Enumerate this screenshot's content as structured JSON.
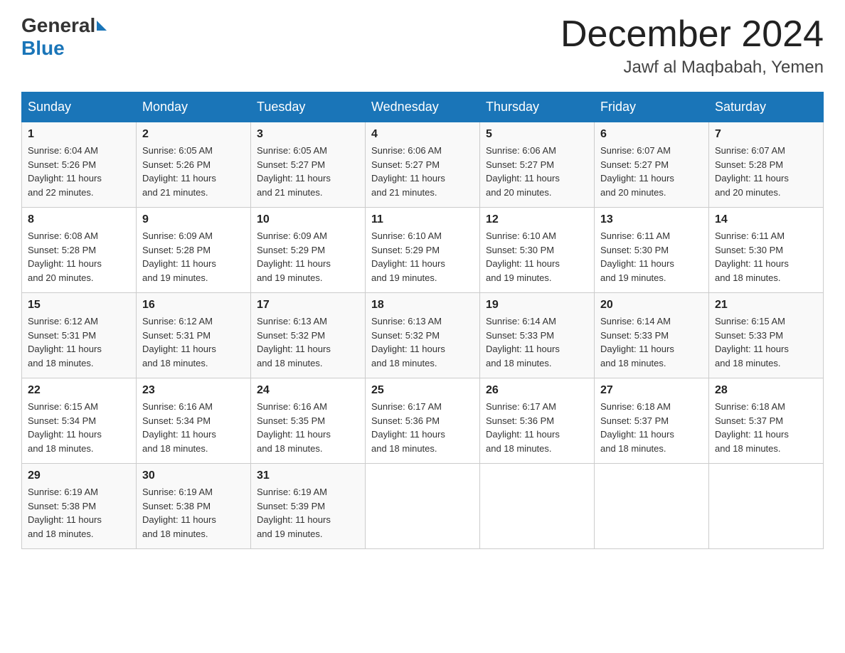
{
  "logo": {
    "general": "General",
    "blue": "Blue"
  },
  "header": {
    "month": "December 2024",
    "location": "Jawf al Maqbabah, Yemen"
  },
  "weekdays": [
    "Sunday",
    "Monday",
    "Tuesday",
    "Wednesday",
    "Thursday",
    "Friday",
    "Saturday"
  ],
  "weeks": [
    [
      {
        "day": "1",
        "sunrise": "6:04 AM",
        "sunset": "5:26 PM",
        "daylight": "11 hours and 22 minutes."
      },
      {
        "day": "2",
        "sunrise": "6:05 AM",
        "sunset": "5:26 PM",
        "daylight": "11 hours and 21 minutes."
      },
      {
        "day": "3",
        "sunrise": "6:05 AM",
        "sunset": "5:27 PM",
        "daylight": "11 hours and 21 minutes."
      },
      {
        "day": "4",
        "sunrise": "6:06 AM",
        "sunset": "5:27 PM",
        "daylight": "11 hours and 21 minutes."
      },
      {
        "day": "5",
        "sunrise": "6:06 AM",
        "sunset": "5:27 PM",
        "daylight": "11 hours and 20 minutes."
      },
      {
        "day": "6",
        "sunrise": "6:07 AM",
        "sunset": "5:27 PM",
        "daylight": "11 hours and 20 minutes."
      },
      {
        "day": "7",
        "sunrise": "6:07 AM",
        "sunset": "5:28 PM",
        "daylight": "11 hours and 20 minutes."
      }
    ],
    [
      {
        "day": "8",
        "sunrise": "6:08 AM",
        "sunset": "5:28 PM",
        "daylight": "11 hours and 20 minutes."
      },
      {
        "day": "9",
        "sunrise": "6:09 AM",
        "sunset": "5:28 PM",
        "daylight": "11 hours and 19 minutes."
      },
      {
        "day": "10",
        "sunrise": "6:09 AM",
        "sunset": "5:29 PM",
        "daylight": "11 hours and 19 minutes."
      },
      {
        "day": "11",
        "sunrise": "6:10 AM",
        "sunset": "5:29 PM",
        "daylight": "11 hours and 19 minutes."
      },
      {
        "day": "12",
        "sunrise": "6:10 AM",
        "sunset": "5:30 PM",
        "daylight": "11 hours and 19 minutes."
      },
      {
        "day": "13",
        "sunrise": "6:11 AM",
        "sunset": "5:30 PM",
        "daylight": "11 hours and 19 minutes."
      },
      {
        "day": "14",
        "sunrise": "6:11 AM",
        "sunset": "5:30 PM",
        "daylight": "11 hours and 18 minutes."
      }
    ],
    [
      {
        "day": "15",
        "sunrise": "6:12 AM",
        "sunset": "5:31 PM",
        "daylight": "11 hours and 18 minutes."
      },
      {
        "day": "16",
        "sunrise": "6:12 AM",
        "sunset": "5:31 PM",
        "daylight": "11 hours and 18 minutes."
      },
      {
        "day": "17",
        "sunrise": "6:13 AM",
        "sunset": "5:32 PM",
        "daylight": "11 hours and 18 minutes."
      },
      {
        "day": "18",
        "sunrise": "6:13 AM",
        "sunset": "5:32 PM",
        "daylight": "11 hours and 18 minutes."
      },
      {
        "day": "19",
        "sunrise": "6:14 AM",
        "sunset": "5:33 PM",
        "daylight": "11 hours and 18 minutes."
      },
      {
        "day": "20",
        "sunrise": "6:14 AM",
        "sunset": "5:33 PM",
        "daylight": "11 hours and 18 minutes."
      },
      {
        "day": "21",
        "sunrise": "6:15 AM",
        "sunset": "5:33 PM",
        "daylight": "11 hours and 18 minutes."
      }
    ],
    [
      {
        "day": "22",
        "sunrise": "6:15 AM",
        "sunset": "5:34 PM",
        "daylight": "11 hours and 18 minutes."
      },
      {
        "day": "23",
        "sunrise": "6:16 AM",
        "sunset": "5:34 PM",
        "daylight": "11 hours and 18 minutes."
      },
      {
        "day": "24",
        "sunrise": "6:16 AM",
        "sunset": "5:35 PM",
        "daylight": "11 hours and 18 minutes."
      },
      {
        "day": "25",
        "sunrise": "6:17 AM",
        "sunset": "5:36 PM",
        "daylight": "11 hours and 18 minutes."
      },
      {
        "day": "26",
        "sunrise": "6:17 AM",
        "sunset": "5:36 PM",
        "daylight": "11 hours and 18 minutes."
      },
      {
        "day": "27",
        "sunrise": "6:18 AM",
        "sunset": "5:37 PM",
        "daylight": "11 hours and 18 minutes."
      },
      {
        "day": "28",
        "sunrise": "6:18 AM",
        "sunset": "5:37 PM",
        "daylight": "11 hours and 18 minutes."
      }
    ],
    [
      {
        "day": "29",
        "sunrise": "6:19 AM",
        "sunset": "5:38 PM",
        "daylight": "11 hours and 18 minutes."
      },
      {
        "day": "30",
        "sunrise": "6:19 AM",
        "sunset": "5:38 PM",
        "daylight": "11 hours and 18 minutes."
      },
      {
        "day": "31",
        "sunrise": "6:19 AM",
        "sunset": "5:39 PM",
        "daylight": "11 hours and 19 minutes."
      },
      null,
      null,
      null,
      null
    ]
  ],
  "labels": {
    "sunrise": "Sunrise:",
    "sunset": "Sunset:",
    "daylight": "Daylight:"
  }
}
